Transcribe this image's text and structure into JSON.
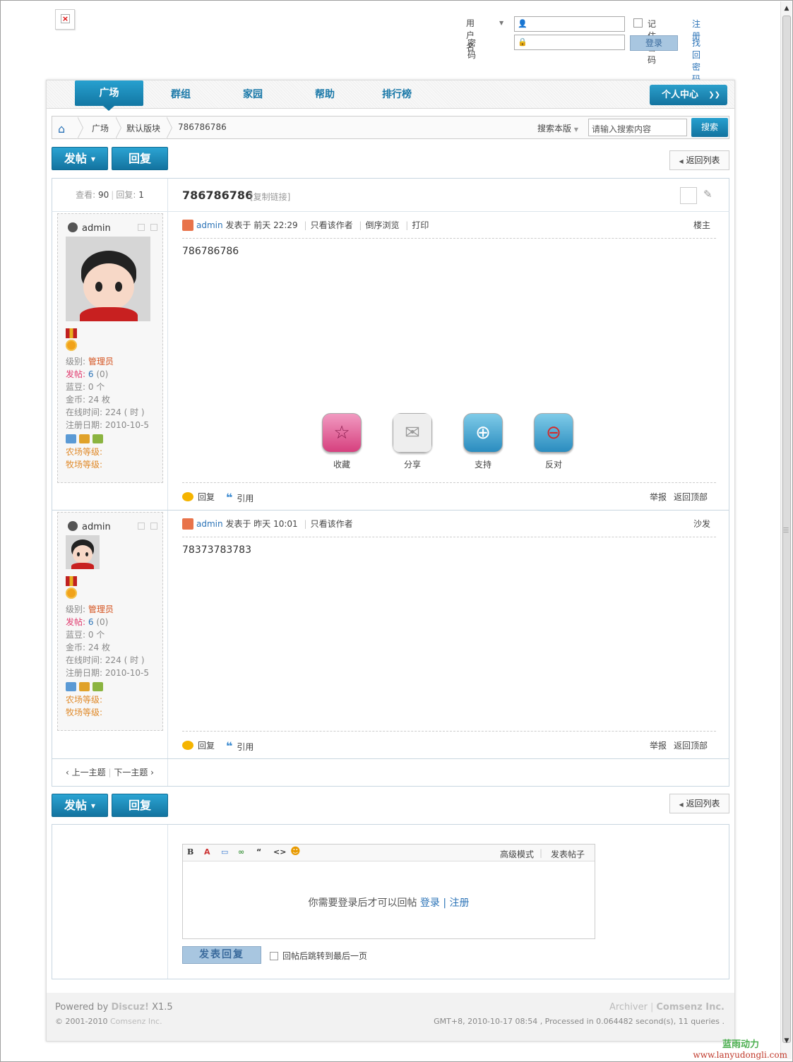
{
  "login": {
    "username_label": "用户名",
    "password_label": "密码",
    "remember_label": "记住密码",
    "login_button": "登录",
    "register_link": "注册",
    "forgot_link": "找回密码"
  },
  "nav": {
    "tabs": [
      {
        "label": "广场"
      },
      {
        "label": "群组"
      },
      {
        "label": "家园"
      },
      {
        "label": "帮助"
      },
      {
        "label": "排行榜"
      }
    ],
    "personal_center": "个人中心"
  },
  "breadcrumb": {
    "items": [
      "广场",
      "默认版块",
      "786786786"
    ],
    "search_scope": "搜索本版",
    "search_placeholder": "请输入搜索内容",
    "search_button": "搜索"
  },
  "toolbar": {
    "post_label": "发帖",
    "reply_label": "回复",
    "back_label": "返回列表"
  },
  "thread": {
    "views_label": "查看:",
    "views": "90",
    "replies_label": "回复:",
    "replies": "1",
    "title": "786786786",
    "copy_link": "[复制链接]"
  },
  "posts": [
    {
      "author": "admin",
      "posted_prefix": "发表于",
      "time": "前天 22:29",
      "only_author": "只看该作者",
      "reverse": "倒序浏览",
      "print": "打印",
      "floor": "楼主",
      "content": "786786786",
      "profile": {
        "level_label": "级别:",
        "level": "管理员",
        "posts_label": "发帖:",
        "posts_count": "6",
        "posts_extra": "(0)",
        "beans": "蓝豆: 0 个",
        "coins": "金币: 24 枚",
        "online": "在线时间: 224 ( 时 )",
        "reg": "注册日期: 2010-10-5",
        "farm": "农场等级:",
        "ranch": "牧场等级:"
      },
      "actions": [
        {
          "label": "收藏",
          "icon": "star-icon",
          "color": "#e0508a"
        },
        {
          "label": "分享",
          "icon": "envelope-icon",
          "color": "#e8e8e8"
        },
        {
          "label": "支持",
          "icon": "plus-icon",
          "color": "#49b34a"
        },
        {
          "label": "反对",
          "icon": "minus-icon",
          "color": "#d42a2a"
        }
      ],
      "reply": "回复",
      "quote": "引用",
      "report": "举报",
      "top": "返回顶部"
    },
    {
      "author": "admin",
      "posted_prefix": "发表于",
      "time": "昨天 10:01",
      "only_author": "只看该作者",
      "floor": "沙发",
      "content": "78373783783",
      "profile": {
        "level_label": "级别:",
        "level": "管理员",
        "posts_label": "发帖:",
        "posts_count": "6",
        "posts_extra": "(0)",
        "beans": "蓝豆: 0 个",
        "coins": "金币: 24 枚",
        "online": "在线时间: 224 ( 时 )",
        "reg": "注册日期: 2010-10-5",
        "farm": "农场等级:",
        "ranch": "牧场等级:"
      },
      "reply": "回复",
      "quote": "引用",
      "report": "举报",
      "top": "返回顶部"
    }
  ],
  "nextprev": {
    "prev": "‹ 上一主题",
    "next": "下一主题 ›"
  },
  "editor": {
    "advanced": "高级模式",
    "submit_post": "发表帖子",
    "message": "你需要登录后才可以回帖",
    "login": "登录",
    "register": "注册",
    "submit_reply": "发表回复",
    "jump_label": "回帖后跳转到最后一页"
  },
  "footer": {
    "powered_prefix": "Powered by",
    "powered_product": "Discuz!",
    "powered_version": "X1.5",
    "copyright": "© 2001-2010",
    "copyright_org": "Comsenz Inc.",
    "archiver": "Archiver",
    "company": "Comsenz Inc.",
    "gmt": "GMT+8, 2010-10-17 08:54 , Processed in 0.064482 second(s), 11 queries ."
  },
  "watermark": {
    "cn": "蓝雨动力",
    "en": "www.lanyudongli.com"
  }
}
